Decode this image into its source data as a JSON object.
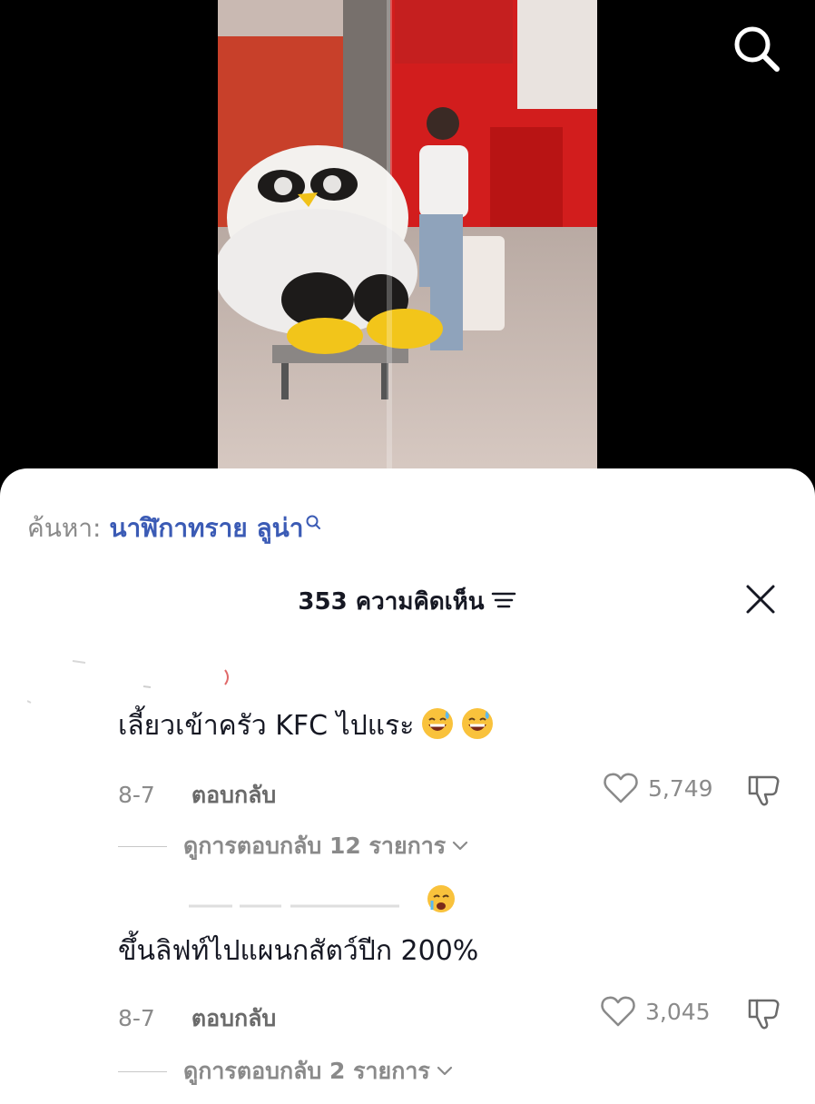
{
  "sheet": {
    "search_prefix": "ค้นหา:",
    "search_keyword": "นาฬิกาทราย ลูน่า",
    "comment_count_label": "353 ความคิดเห็น",
    "icons": {
      "search": "search-icon",
      "sort": "sort-icon",
      "close": "close-icon"
    }
  },
  "comments": [
    {
      "text": "เลี้ยวเข้าครัว KFC ไปแระ",
      "emoji": [
        "grinning-sweat-emoji",
        "grinning-sweat-emoji"
      ],
      "date": "8-7",
      "reply_label": "ตอบกลับ",
      "likes": "5,749",
      "view_replies": "ดูการตอบกลับ 12 รายการ"
    },
    {
      "text": "ขึ้นลิฟท์ไปแผนกสัตว์ปีก 200%",
      "date": "8-7",
      "reply_label": "ตอบกลับ",
      "likes": "3,045",
      "view_replies": "ดูการตอบกลับ 2 รายการ"
    }
  ],
  "colors": {
    "keyword": "#3b5bb5",
    "muted": "#8a8a8a",
    "text": "#161823"
  }
}
